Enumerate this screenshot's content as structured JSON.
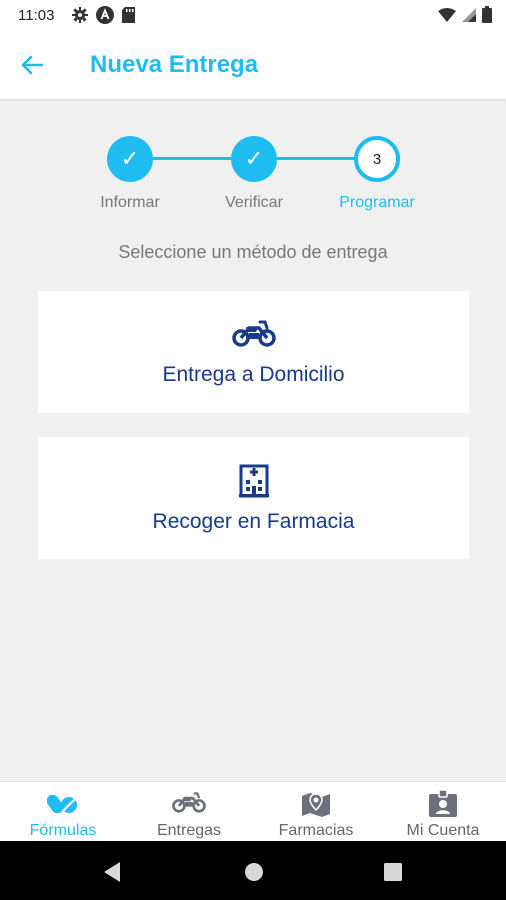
{
  "status": {
    "time": "11:03",
    "left_icons": [
      "gear-icon",
      "app-a-icon",
      "sd-card-icon"
    ],
    "right_icons": [
      "wifi-icon",
      "signal-icon",
      "battery-icon"
    ]
  },
  "appbar": {
    "title": "Nueva Entrega",
    "back_icon": "arrow-left-icon"
  },
  "stepper": {
    "steps": [
      {
        "label": "Informar",
        "state": "done",
        "mark": "✓"
      },
      {
        "label": "Verificar",
        "state": "done",
        "mark": "✓"
      },
      {
        "label": "Programar",
        "state": "current",
        "mark": "3"
      }
    ]
  },
  "main": {
    "prompt": "Seleccione un método de entrega",
    "options": [
      {
        "label": "Entrega a Domicilio",
        "icon": "motorcycle-icon"
      },
      {
        "label": "Recoger en Farmacia",
        "icon": "pharmacy-building-icon"
      }
    ]
  },
  "bottom_nav": {
    "items": [
      {
        "label": "Fórmulas",
        "icon": "pills-icon",
        "active": true
      },
      {
        "label": "Entregas",
        "icon": "motorcycle-icon",
        "active": false
      },
      {
        "label": "Farmacias",
        "icon": "map-pin-icon",
        "active": false
      },
      {
        "label": "Mi Cuenta",
        "icon": "id-badge-icon",
        "active": false
      }
    ]
  },
  "colors": {
    "accent": "#1fbcf2",
    "primary_dark": "#173a8a",
    "muted_text": "#777777",
    "background": "#f0f0f0"
  }
}
